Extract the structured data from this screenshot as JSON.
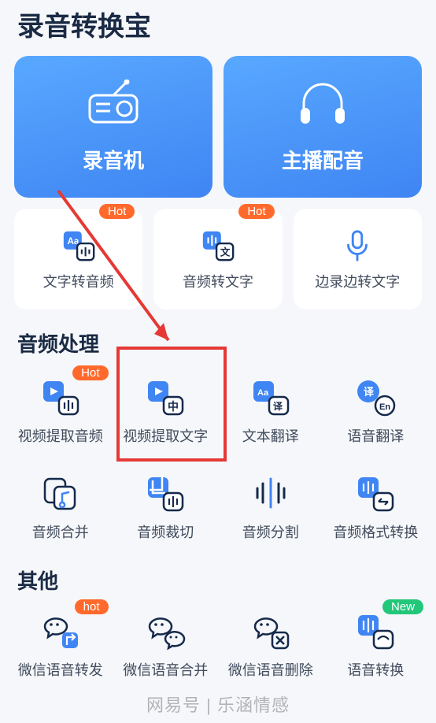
{
  "app_title": "录音转换宝",
  "hero": {
    "recorder": "录音机",
    "dubbing": "主播配音"
  },
  "features": {
    "text_to_audio": "文字转音频",
    "audio_to_text": "音频转文字",
    "record_convert": "边录边转文字",
    "hot_badge": "Hot"
  },
  "sections": {
    "audio_processing": "音频处理",
    "other": "其他"
  },
  "grid_audio": {
    "video_extract_audio": "视频提取音频",
    "video_extract_text": "视频提取文字",
    "text_translate": "文本翻译",
    "voice_translate": "语音翻译",
    "audio_merge": "音频合并",
    "audio_crop": "音频裁切",
    "audio_split": "音频分割",
    "audio_format": "音频格式转换"
  },
  "grid_other": {
    "wechat_forward": "微信语音转发",
    "wechat_merge": "微信语音合并",
    "item3": "微信语音删除",
    "item4": "语音转换"
  },
  "badges": {
    "hot": "Hot",
    "hot_lower": "hot",
    "new": "New"
  },
  "watermark": "网易号 | 乐涵情感"
}
